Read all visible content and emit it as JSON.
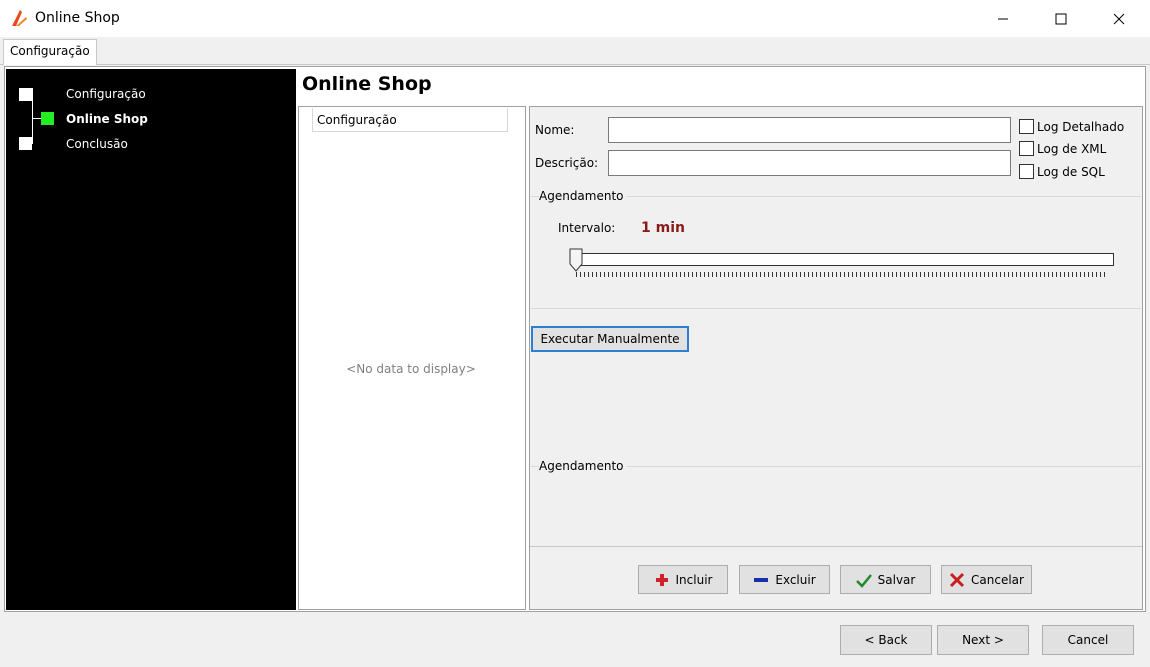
{
  "window": {
    "title": "Online Shop"
  },
  "tabs": [
    {
      "label": "Configuração"
    }
  ],
  "nav": {
    "items": [
      {
        "label": "Configuração",
        "active": false
      },
      {
        "label": "Online Shop",
        "active": true
      },
      {
        "label": "Conclusão",
        "active": false
      }
    ]
  },
  "page": {
    "title": "Online Shop"
  },
  "grid": {
    "column_header": "Configuração",
    "empty_text": "<No data to display>"
  },
  "form": {
    "name_label": "Nome:",
    "name_value": "",
    "description_label": "Descrição:",
    "description_value": "",
    "checkboxes": [
      {
        "label": "Log Detalhado",
        "checked": false
      },
      {
        "label": "Log de XML",
        "checked": false
      },
      {
        "label": "Log de SQL",
        "checked": false
      }
    ]
  },
  "schedule": {
    "group_title": "Agendamento",
    "interval_label": "Intervalo:",
    "interval_value": "1 min",
    "slider_level": 0
  },
  "execute_button": "Executar Manualmente",
  "schedule_list": {
    "group_title": "Agendamento"
  },
  "actions": {
    "add": "Incluir",
    "delete": "Excluir",
    "save": "Salvar",
    "cancel": "Cancelar"
  },
  "wizard": {
    "back": "< Back",
    "next": "Next >",
    "cancel": "Cancel"
  },
  "colors": {
    "nav_background": "#000000",
    "nav_active": "#22ee22",
    "interval_value": "#8b1a1a",
    "focus_border": "#2d7fd4"
  }
}
